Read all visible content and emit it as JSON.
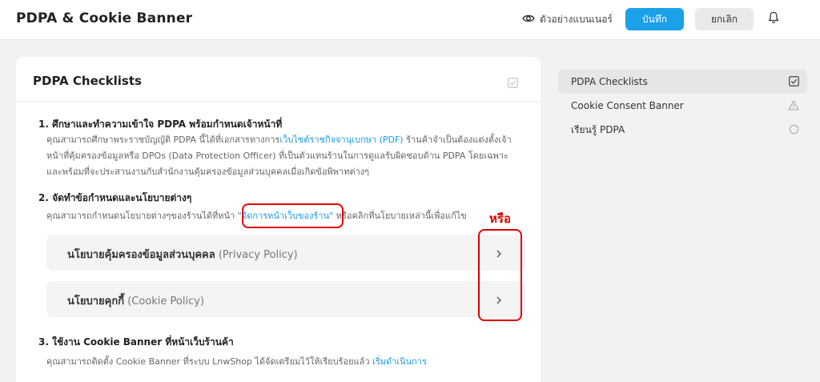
{
  "header": {
    "title": "PDPA & Cookie Banner",
    "preview_label": "ตัวอย่างแบนเนอร์",
    "save_label": "บันทึก",
    "cancel_label": "ยกเลิก"
  },
  "card": {
    "title": "PDPA Checklists",
    "sections": [
      {
        "title": "1. ศึกษาและทำความเข้าใจ PDPA พร้อมกำหนดเจ้าหน้าที่",
        "body_pre": "คุณสามารถศึกษาพระราชบัญญัติ PDPA นี้ได้ที่เอกสารทางการ",
        "body_link": "เว็บไซต์ราชกิจจานุเบกษา (PDF)",
        "body_post": " ร้านค้าจำเป็นต้องแต่งตั้งเจ้าหน้าที่คุ้มครองข้อมูลหรือ DPOs (Data Protection Officer) ที่เป็นตัวแทนร้านในการดูแลรับผิดชอบด้าน PDPA โดยเฉพาะ และพร้อมที่จะประสานงานกับสำนักงานคุ้มครองข้อมูลส่วนบุคคลเมื่อเกิดข้อพิพาทต่างๆ"
      },
      {
        "title": "2. จัดทำข้อกำหนดและนโยบายต่างๆ",
        "body_pre": "คุณสามารถกำหนดนโยบายต่างๆของร้านได้ที่หน้า ",
        "body_link": "\"จัดการหน้าเว็บของร้าน\"",
        "body_post": " หรือคลิกที่นโยบายเหล่านี้เพื่อแก้ไข"
      },
      {
        "title": "3. ใช้งาน Cookie Banner ที่หน้าเว็บร้านค้า",
        "body_pre": "คุณสามารถติดตั้ง Cookie Banner ที่ระบบ LnwShop ได้จัดเตรียมไว้ให้เรียบร้อยแล้ว ",
        "body_link": "เริ่มดำเนินการ",
        "body_post": ""
      }
    ],
    "policies": [
      {
        "th": "นโยบายคุ้มครองข้อมูลส่วนบุคคล",
        "en": " (Privacy Policy)"
      },
      {
        "th": "นโยบายคุกกี้",
        "en": " (Cookie Policy)"
      }
    ]
  },
  "annotation": {
    "label": "หรือ",
    "color": "#e00000"
  },
  "sidebar": {
    "items": [
      {
        "label": "PDPA Checklists",
        "icon": "checked-box-icon",
        "active": true
      },
      {
        "label": "Cookie Consent Banner",
        "icon": "warning-triangle-icon",
        "active": false
      },
      {
        "label": "เรียนรู้ PDPA",
        "icon": "circle-icon",
        "active": false
      }
    ]
  },
  "colors": {
    "accent": "#1aa1e8",
    "link": "#1a9be0",
    "highlight": "#e00000"
  }
}
